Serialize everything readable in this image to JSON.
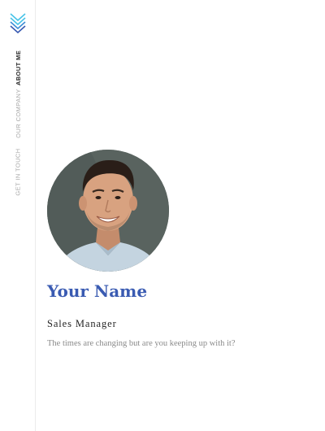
{
  "nav": {
    "items": [
      {
        "label": "About Me",
        "active": true
      },
      {
        "label": "Our Company",
        "active": false
      },
      {
        "label": "Get In Touch",
        "active": false
      }
    ]
  },
  "profile": {
    "name": "Your Name",
    "job_title": "Sales Manager",
    "tagline": "The times are changing but are you keeping up with it?"
  },
  "colors": {
    "accent": "#3a5bb2",
    "logo_light": "#49c4e8",
    "logo_dark": "#3a5bb2"
  },
  "icons": {
    "logo": "chevron-stack-logo-icon"
  }
}
